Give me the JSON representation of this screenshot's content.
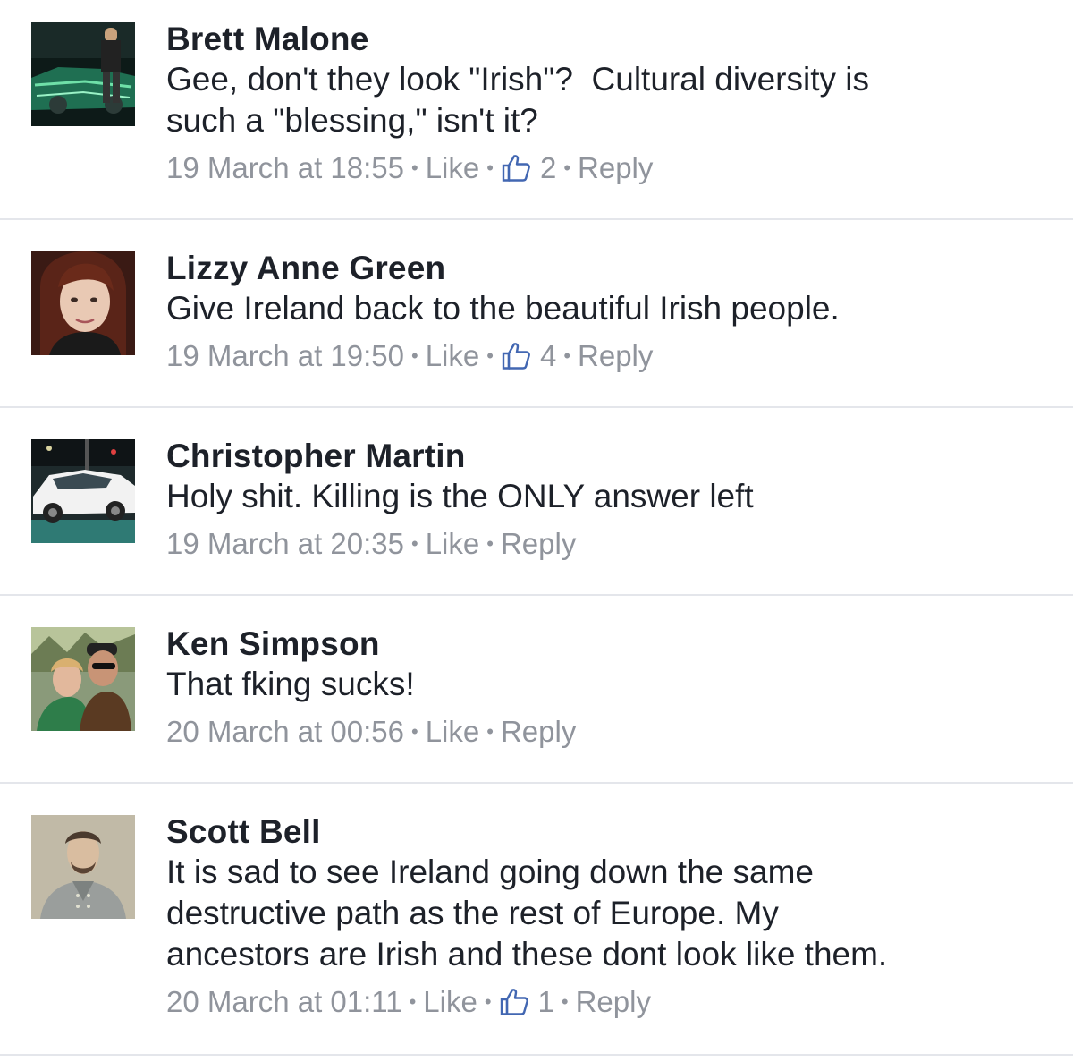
{
  "comments": [
    {
      "author": "Brett Malone",
      "text": "Gee, don't they look \"Irish\"?  Cultural diversity is\nsuch a \"blessing,\" isn't it?",
      "timestamp": "19 March at 18:55",
      "like_label": "Like",
      "like_count": "2",
      "reply_label": "Reply",
      "avatar_icon": "profile-photo-car"
    },
    {
      "author": "Lizzy Anne Green",
      "text": "Give Ireland back to the beautiful Irish people.",
      "timestamp": "19 March at 19:50",
      "like_label": "Like",
      "like_count": "4",
      "reply_label": "Reply",
      "avatar_icon": "profile-photo-woman"
    },
    {
      "author": "Christopher Martin",
      "text": "Holy shit. Killing is the ONLY answer left",
      "timestamp": "19 March at 20:35",
      "like_label": "Like",
      "reply_label": "Reply",
      "avatar_icon": "profile-photo-white-car"
    },
    {
      "author": "Ken Simpson",
      "text": "That fking sucks!",
      "timestamp": "20 March at 00:56",
      "like_label": "Like",
      "reply_label": "Reply",
      "avatar_icon": "profile-photo-couple"
    },
    {
      "author": "Scott Bell",
      "text": "It is sad to see Ireland going down the same\ndestructive path as the rest of Europe. My\nancestors are Irish and these dont look like them.",
      "timestamp": "20 March at 01:11",
      "like_label": "Like",
      "like_count": "1",
      "reply_label": "Reply",
      "avatar_icon": "profile-photo-portrait-painting"
    }
  ],
  "colors": {
    "text": "#1d2129",
    "meta": "#90949c",
    "divider": "#e4e6eb",
    "like_icon": "#4267b2"
  }
}
